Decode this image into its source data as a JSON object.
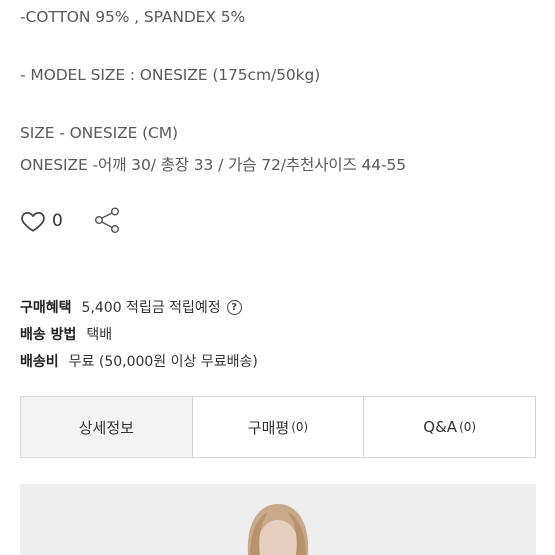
{
  "description": {
    "material": "-COTTON 95% , SPANDEX 5%",
    "model_size": "- MODEL SIZE : ONESIZE (175cm/50kg)",
    "size_title": "SIZE - ONESIZE (CM)",
    "size_detail": "ONESIZE -어깨 30/ 총장 33 / 가슴 72/추천사이즈 44-55"
  },
  "social": {
    "like_count": "0",
    "like_icon": "heart-icon",
    "share_icon": "share-icon"
  },
  "purchase_info": {
    "benefit_label": "구매혜택",
    "benefit_value": "5,400 적립금 적립예정",
    "help_symbol": "?",
    "shipping_method_label": "배송 방법",
    "shipping_method_value": "택배",
    "shipping_fee_label": "배송비",
    "shipping_fee_value": "무료 (50,000원 이상 무료배송)"
  },
  "tabs": {
    "detail": "상세정보",
    "reviews": "구매평",
    "reviews_count": "(0)",
    "qna": "Q&A",
    "qna_count": "(0)"
  },
  "colors": {
    "active_tab_bg": "#f3f3f3",
    "border": "#d8d8d8",
    "image_bg": "#eeeeee"
  }
}
